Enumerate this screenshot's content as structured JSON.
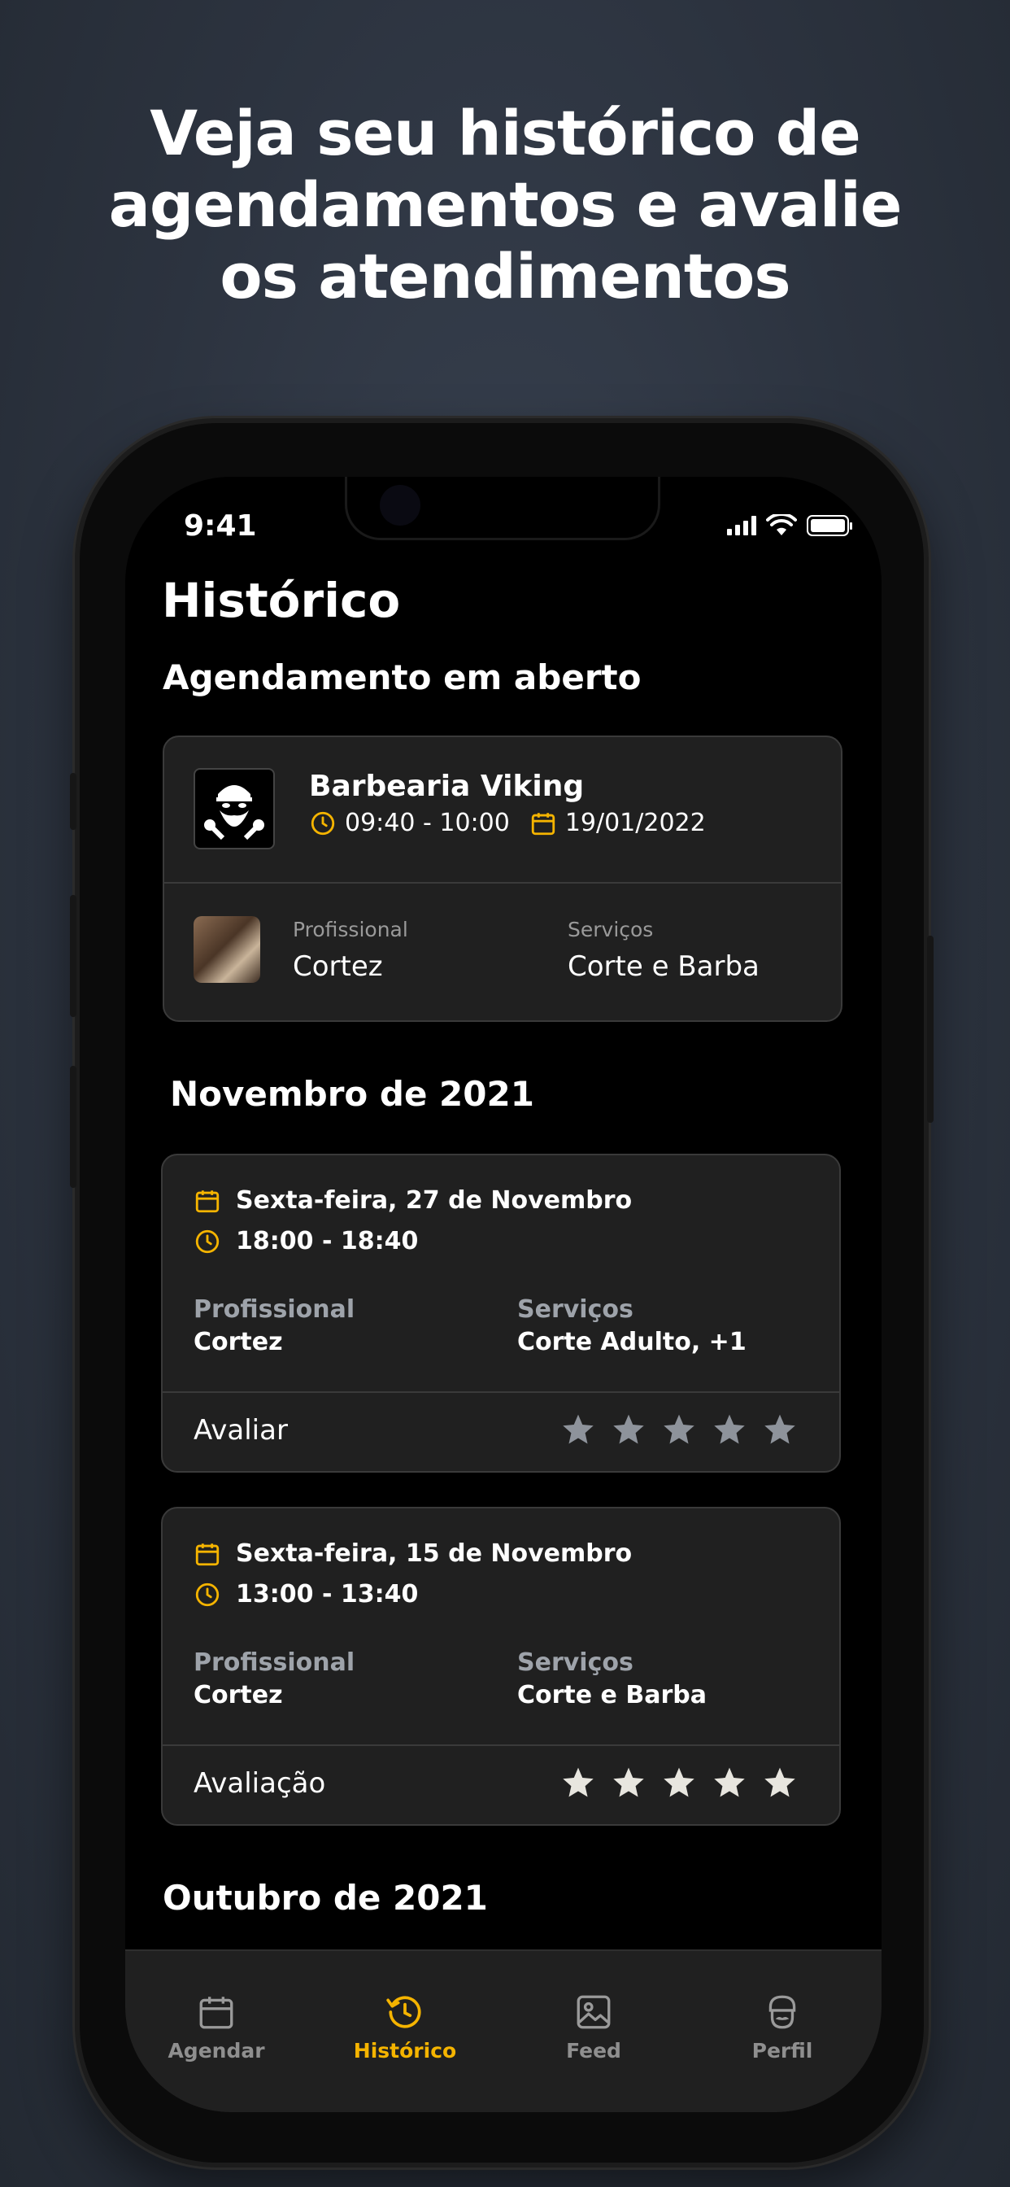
{
  "headline": {
    "line1": "Veja seu histórico de",
    "line2": "agendamentos e avalie",
    "line3": "os atendimentos"
  },
  "status_bar": {
    "time": "9:41"
  },
  "page_title": "Histórico",
  "open_section": {
    "title": "Agendamento em aberto",
    "shop_name": "Barbearia Viking",
    "time": "09:40 - 10:00",
    "date": "19/01/2022",
    "professional_label": "Profissional",
    "professional": "Cortez",
    "services_label": "Serviços",
    "services": "Corte e Barba"
  },
  "month_1": "Novembro de 2021",
  "history": [
    {
      "date": "Sexta-feira, 27 de Novembro",
      "time": "18:00 - 18:40",
      "professional_label": "Profissional",
      "professional": "Cortez",
      "services_label": "Serviços",
      "services": "Corte Adulto, +1",
      "rating_label": "Avaliar",
      "rating": 0
    },
    {
      "date": "Sexta-feira, 15 de Novembro",
      "time": "13:00 - 13:40",
      "professional_label": "Profissional",
      "professional": "Cortez",
      "services_label": "Serviços",
      "services": "Corte e Barba",
      "rating_label": "Avaliação",
      "rating": 5
    }
  ],
  "month_2": "Outubro de 2021",
  "tabs": [
    {
      "label": "Agendar",
      "icon": "calendar-icon"
    },
    {
      "label": "Histórico",
      "icon": "history-icon",
      "active": true
    },
    {
      "label": "Feed",
      "icon": "image-icon"
    },
    {
      "label": "Perfil",
      "icon": "barber-profile-icon"
    }
  ],
  "colors": {
    "accent": "#f5b400",
    "card_bg": "#202020",
    "star_empty": "#8e939b",
    "star_filled": "#e8e6df"
  }
}
